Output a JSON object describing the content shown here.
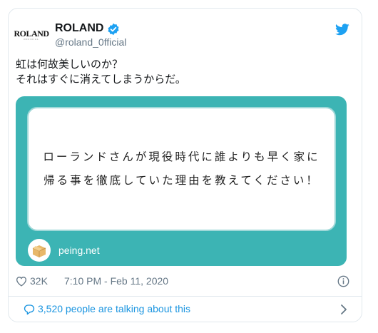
{
  "account": {
    "avatar_text": "ROLAND",
    "avatar_subtext": "OFFICIAL",
    "display_name": "ROLAND",
    "handle": "@roland_0fficial"
  },
  "tweet": {
    "lines": [
      "虹は何故美しいのか？",
      "それはすぐに消えてしまうからだ。"
    ]
  },
  "media": {
    "question_lines": [
      "ローランドさんが現役時代に誰よりも早く家に",
      "帰る事を徹底していた理由を教えてください！"
    ],
    "site": "peing.net",
    "background_color": "#3cb4b4"
  },
  "meta": {
    "likes": "32K",
    "timestamp": "7:10 PM - Feb 11, 2020"
  },
  "conversation": {
    "label": "3,520 people are talking about this"
  },
  "colors": {
    "accent": "#1da1f2",
    "link": "#1b95e0",
    "muted": "#657786"
  },
  "icons": [
    "verified-badge-icon",
    "twitter-bird-icon",
    "heart-icon",
    "info-icon",
    "speech-bubble-icon",
    "chevron-right-icon",
    "peing-box-icon"
  ]
}
